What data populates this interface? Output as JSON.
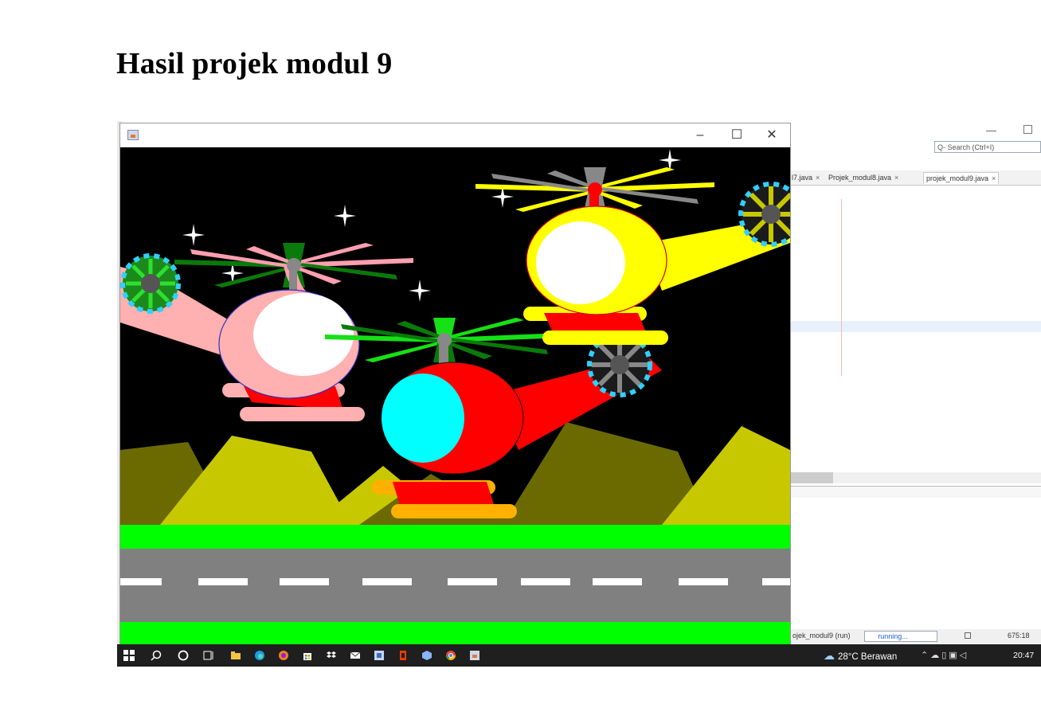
{
  "page": {
    "title": "Hasil projek modul 9"
  },
  "ide": {
    "search_placeholder": "Q- Search (Ctrl+I)",
    "tabs": [
      {
        "label": "l7.java",
        "active": false
      },
      {
        "label": "Projek_modul8.java",
        "active": false
      },
      {
        "label": "projek_modul9.java",
        "active": true
      }
    ],
    "tab_close": "×",
    "status": {
      "project": "ojek_modul9 (run)",
      "running": "running...",
      "position": "675:18"
    }
  },
  "frame": {
    "minimize": "–",
    "maximize": "☐",
    "close": "✕"
  },
  "scene": {
    "colors": {
      "sky": "#000000",
      "mountain_dark": "#6b6a00",
      "mountain_light": "#c8c800",
      "grass": "#00ff00",
      "road": "#808080",
      "lane": "#ffffff"
    },
    "helicopters": [
      {
        "name": "pink",
        "body": "#ffb0b0",
        "window": "#ffffff"
      },
      {
        "name": "red",
        "body": "#ff0000",
        "window": "#00ffff"
      },
      {
        "name": "yellow",
        "body": "#ffff00",
        "window": "#ffffff"
      }
    ]
  },
  "taskbar": {
    "icons": [
      "windows-start-icon",
      "search-icon",
      "cortana-icon",
      "task-view-icon",
      "file-explorer-icon",
      "edge-icon",
      "firefox-icon",
      "store-icon",
      "dropbox-icon",
      "mail-icon",
      "netbeans-icon",
      "office-icon",
      "box-icon",
      "chrome-icon",
      "java-app-icon"
    ],
    "weather_temp": "28°C",
    "weather_text": "Berawan",
    "time": "20:47"
  }
}
